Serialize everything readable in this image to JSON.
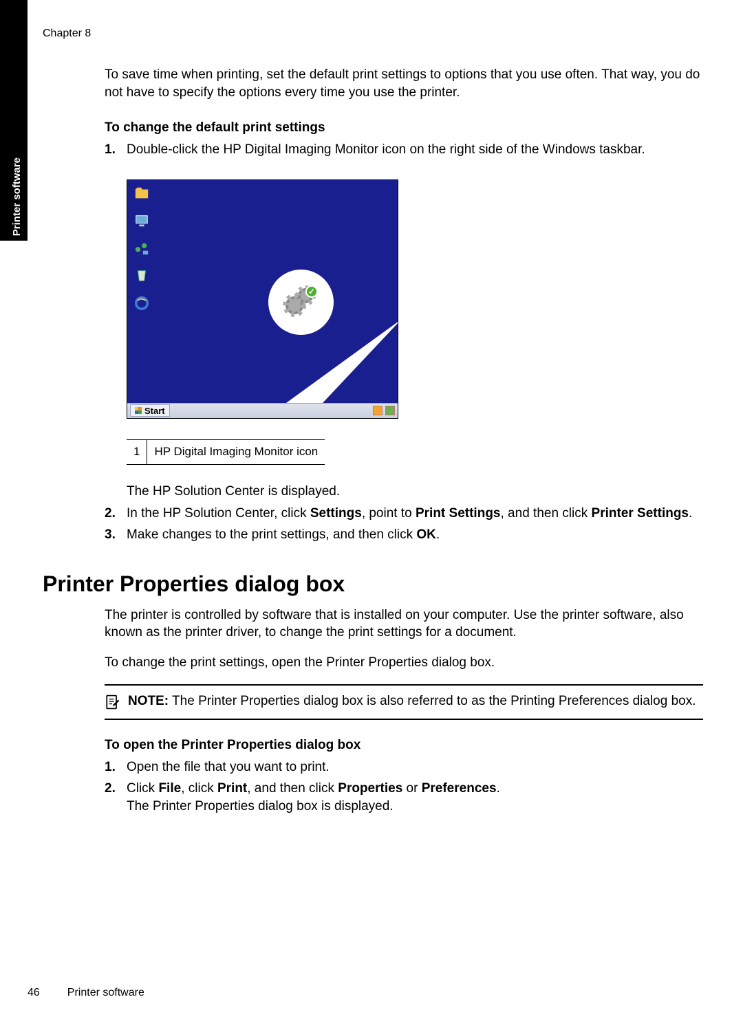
{
  "chapter": "Chapter 8",
  "sidebarLabel": "Printer software",
  "intro": "To save time when printing, set the default print settings to options that you use often. That way, you do not have to specify the options every time you use the printer.",
  "subhead1": "To change the default print settings",
  "step1": "Double-click the HP Digital Imaging Monitor icon on the right side of the Windows taskbar.",
  "startLabel": "Start",
  "legendNum": "1",
  "legendText": "HP Digital Imaging Monitor icon",
  "afterImg": "The HP Solution Center is displayed.",
  "step2_pre": "In the HP Solution Center, click ",
  "step2_b1": "Settings",
  "step2_mid1": ", point to ",
  "step2_b2": "Print Settings",
  "step2_mid2": ", and then click ",
  "step2_b3": "Printer Settings",
  "step2_end": ".",
  "step3_pre": "Make changes to the print settings, and then click ",
  "step3_b1": "OK",
  "step3_end": ".",
  "sectionTitle": "Printer Properties dialog box",
  "para1": "The printer is controlled by software that is installed on your computer. Use the printer software, also known as the printer driver, to change the print settings for a document.",
  "para2": "To change the print settings, open the Printer Properties dialog box.",
  "noteLabel": "NOTE:",
  "noteText": " The Printer Properties dialog box is also referred to as the Printing Preferences dialog box.",
  "subhead2": "To open the Printer Properties dialog box",
  "stepA": "Open the file that you want to print.",
  "stepB_pre": "Click ",
  "stepB_b1": "File",
  "stepB_mid1": ", click ",
  "stepB_b2": "Print",
  "stepB_mid2": ", and then click ",
  "stepB_b3": "Properties",
  "stepB_mid3": " or ",
  "stepB_b4": "Preferences",
  "stepB_end": ".",
  "stepB_line2": "The Printer Properties dialog box is displayed.",
  "pageNum": "46",
  "footerTitle": "Printer software"
}
